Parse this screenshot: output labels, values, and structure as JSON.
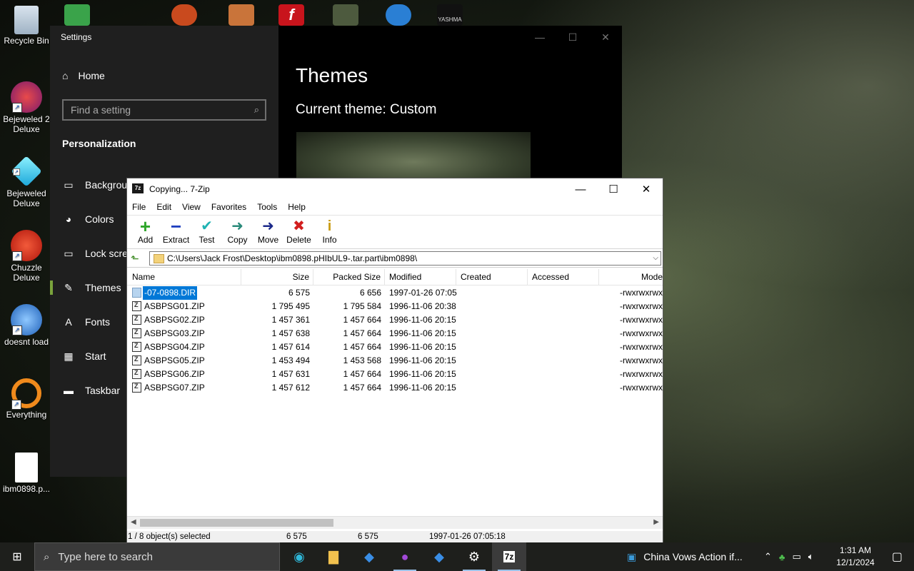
{
  "desktop": {
    "icons": [
      {
        "label": "Recycle Bin"
      },
      {
        "label": "Bejeweled 2 Deluxe"
      },
      {
        "label": "Bejeweled Deluxe"
      },
      {
        "label": "Chuzzle Deluxe"
      },
      {
        "label": "doesnt load"
      },
      {
        "label": "Everything"
      },
      {
        "label": "ibm0898.p..."
      }
    ],
    "top_icon_text": "YASHMA"
  },
  "settings": {
    "title": "Settings",
    "home": "Home",
    "search_placeholder": "Find a setting",
    "section": "Personalization",
    "nav": [
      "Background",
      "Colors",
      "Lock screen",
      "Themes",
      "Fonts",
      "Start",
      "Taskbar"
    ],
    "active_nav": "Themes",
    "heading": "Themes",
    "current_theme": "Current theme: Custom"
  },
  "zip": {
    "title": "Copying... 7-Zip",
    "app_icon_text": "7z",
    "menu": [
      "File",
      "Edit",
      "View",
      "Favorites",
      "Tools",
      "Help"
    ],
    "toolbar": [
      "Add",
      "Extract",
      "Test",
      "Copy",
      "Move",
      "Delete",
      "Info"
    ],
    "path": "C:\\Users\\Jack Frost\\Desktop\\ibm0898.pHIbUL9-.tar.part\\ibm0898\\",
    "columns": [
      "Name",
      "Size",
      "Packed Size",
      "Modified",
      "Created",
      "Accessed",
      "Mode"
    ],
    "files": [
      {
        "name": "-07-0898.DIR",
        "size": "6 575",
        "packed": "6 656",
        "modified": "1997-01-26 07:05",
        "mode": "-rwxrwxrwx",
        "type": "dir",
        "selected": true
      },
      {
        "name": "ASBPSG01.ZIP",
        "size": "1 795 495",
        "packed": "1 795 584",
        "modified": "1996-11-06 20:38",
        "mode": "-rwxrwxrwx",
        "type": "zip"
      },
      {
        "name": "ASBPSG02.ZIP",
        "size": "1 457 361",
        "packed": "1 457 664",
        "modified": "1996-11-06 20:15",
        "mode": "-rwxrwxrwx",
        "type": "zip"
      },
      {
        "name": "ASBPSG03.ZIP",
        "size": "1 457 638",
        "packed": "1 457 664",
        "modified": "1996-11-06 20:15",
        "mode": "-rwxrwxrwx",
        "type": "zip"
      },
      {
        "name": "ASBPSG04.ZIP",
        "size": "1 457 614",
        "packed": "1 457 664",
        "modified": "1996-11-06 20:15",
        "mode": "-rwxrwxrwx",
        "type": "zip"
      },
      {
        "name": "ASBPSG05.ZIP",
        "size": "1 453 494",
        "packed": "1 453 568",
        "modified": "1996-11-06 20:15",
        "mode": "-rwxrwxrwx",
        "type": "zip"
      },
      {
        "name": "ASBPSG06.ZIP",
        "size": "1 457 631",
        "packed": "1 457 664",
        "modified": "1996-11-06 20:15",
        "mode": "-rwxrwxrwx",
        "type": "zip"
      },
      {
        "name": "ASBPSG07.ZIP",
        "size": "1 457 612",
        "packed": "1 457 664",
        "modified": "1996-11-06 20:15",
        "mode": "-rwxrwxrwx",
        "type": "zip"
      }
    ],
    "status": {
      "selection": "1 / 8 object(s) selected",
      "size": "6 575",
      "packed": "6 575",
      "modified": "1997-01-26 07:05:18"
    }
  },
  "taskbar": {
    "search_placeholder": "Type here to search",
    "news": "China Vows Action if...",
    "time": "1:31 AM",
    "date": "12/1/2024"
  },
  "colors": {
    "accent": "#0078d7",
    "settings_active_bar": "#7aa33c"
  }
}
